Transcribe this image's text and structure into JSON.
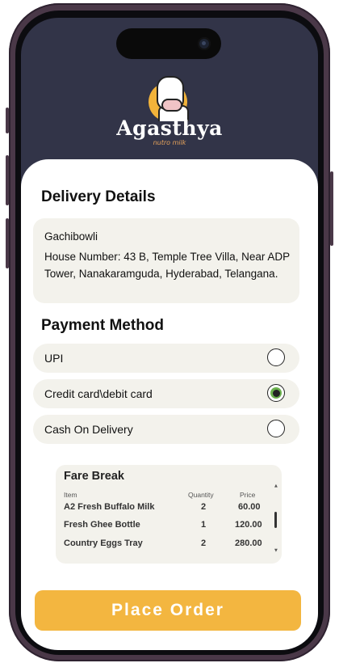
{
  "brand": {
    "name": "Agasthya",
    "tagline": "nutro milk"
  },
  "delivery": {
    "heading": "Delivery Details",
    "area": "Gachibowli",
    "address": "House Number: 43 B, Temple Tree Villa, Near ADP Tower, Nanakaramguda, Hyderabad, Telangana."
  },
  "payment": {
    "heading": "Payment Method",
    "options": [
      {
        "label": "UPI",
        "selected": false
      },
      {
        "label": "Credit card\\debit card",
        "selected": true
      },
      {
        "label": "Cash On Delivery",
        "selected": false
      }
    ]
  },
  "fare": {
    "title": "Fare Break",
    "columns": [
      "Item",
      "Quantity",
      "Price"
    ],
    "rows": [
      {
        "item": "A2 Fresh  Buffalo Milk",
        "quantity": "2",
        "price": "60.00"
      },
      {
        "item": "Fresh Ghee Bottle",
        "quantity": "1",
        "price": "120.00"
      },
      {
        "item": "Country Eggs Tray",
        "quantity": "2",
        "price": "280.00"
      }
    ]
  },
  "actions": {
    "place_order": "Place Order"
  },
  "colors": {
    "header_bg": "#323448",
    "accent": "#f3b640",
    "selected_radio": "#6ab04c",
    "box_bg": "#f3f2ec"
  }
}
